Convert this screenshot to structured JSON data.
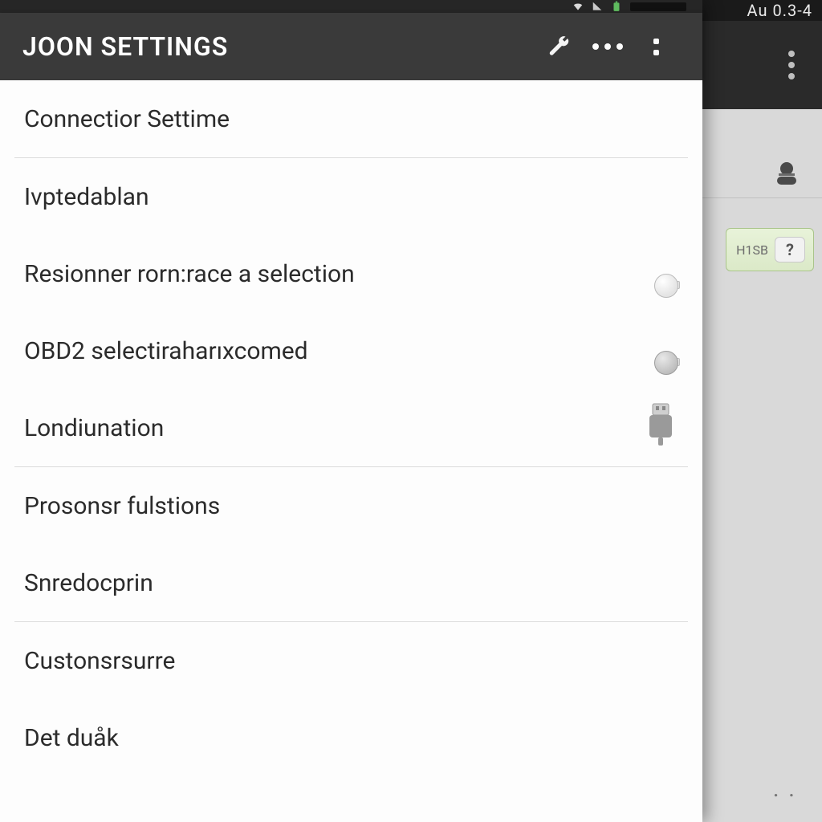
{
  "background": {
    "status_text": "Au  0.3-4",
    "help_label": "H1SB",
    "help_mark": "?"
  },
  "appbar": {
    "title": "JOON SETTINGS"
  },
  "rows": {
    "connector": "Connectior Settime",
    "ivptedablan": "Ivptedablan",
    "resionner": "Resionner rorn:race a selection",
    "obd2": "OBD2 selectiraharıxcomed",
    "londiunation": "Londiunation",
    "prosonsr": "Prosonsr fulstions",
    "snredocprin": "Snredocprin",
    "custonsrsurre": "Custonsrsurre",
    "detduak": "Det duåk"
  }
}
